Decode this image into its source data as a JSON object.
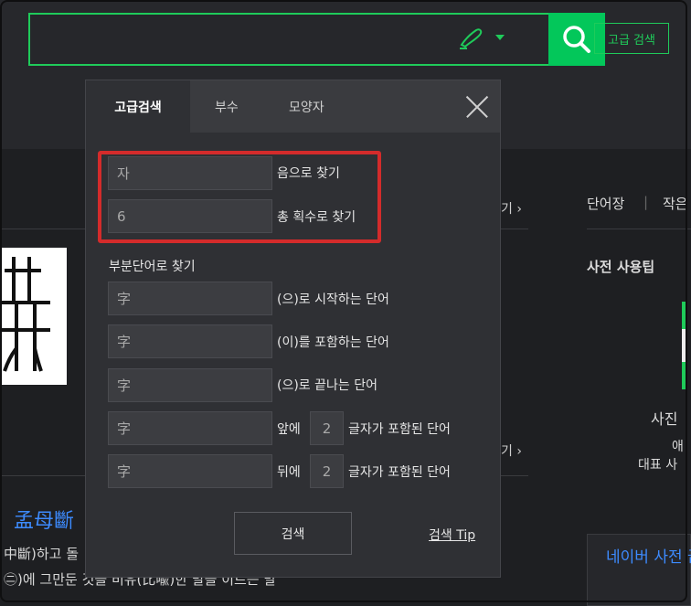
{
  "search": {
    "placeholder": "",
    "advanced_button": "고급 검색"
  },
  "background": {
    "more_link_1": "기 ›",
    "more_link_2": "기 ›",
    "entry_title": "孟母斷",
    "line_1": "中斷)하고 돌",
    "line_2": "㊁)에 그만둔 것을 비유(比喩)한 말을 이르는 말"
  },
  "right": {
    "wordbook": "단어장",
    "separator": "|",
    "small": "작은",
    "usage_tip_title": "사전 사용팁",
    "photo": "사진",
    "ae": "애",
    "representative": "대표 사",
    "card_title": "네이버 사전 끝!"
  },
  "popup": {
    "tabs": [
      "고급검색",
      "부수",
      "모양자"
    ],
    "active_tab": 0,
    "sound": {
      "value": "자",
      "label": "음으로 찾기"
    },
    "strokes": {
      "value": "6",
      "label": "총 획수로 찾기"
    },
    "partial_section": "부분단어로 찾기",
    "partial_fields": [
      {
        "value": "字",
        "label": "(으)로 시작하는 단어"
      },
      {
        "value": "字",
        "label": "(이)를 포함하는 단어"
      },
      {
        "value": "字",
        "label": "(으)로 끝나는 단어"
      }
    ],
    "position_fields": [
      {
        "value": "字",
        "prefix": "앞에",
        "count": "2",
        "label": "글자가 포함된 단어"
      },
      {
        "value": "字",
        "prefix": "뒤에",
        "count": "2",
        "label": "글자가 포함된 단어"
      }
    ],
    "submit": "검색",
    "tip": "검색 Tip"
  },
  "colors": {
    "accent": "#03c75a",
    "highlight": "#d42b2b",
    "link_blue": "#3d8bff"
  }
}
